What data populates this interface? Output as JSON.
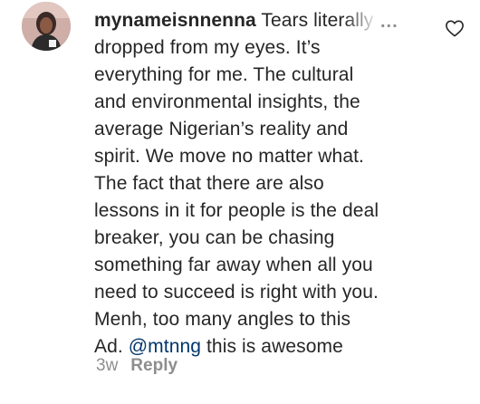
{
  "comment": {
    "avatar_icon": "user-avatar-photo",
    "username": "mynameisnnenna",
    "first_text": "Tears lite",
    "first_text_faded": "rally",
    "lines": [
      "dropped from my eyes. It’s",
      "everything for me. The cultural",
      "and environmental insights, the",
      "average Nigerian’s reality and",
      "spirit. We move no matter what.",
      "The fact that there are also",
      "lessons in it for people is the deal",
      "breaker, you can be chasing",
      "something far away when all you",
      "need to succeed is right with you.",
      "Menh, too many angles to this"
    ],
    "last_line_before": "Ad. ",
    "mention": "@mtnng",
    "last_line_after": " this is awesome",
    "more_label": "...",
    "like_icon": "heart-outline-icon",
    "time": "3w",
    "reply_label": "Reply"
  },
  "colors": {
    "text": "#262626",
    "secondary": "#8e8e8e",
    "mention": "#00376b"
  }
}
